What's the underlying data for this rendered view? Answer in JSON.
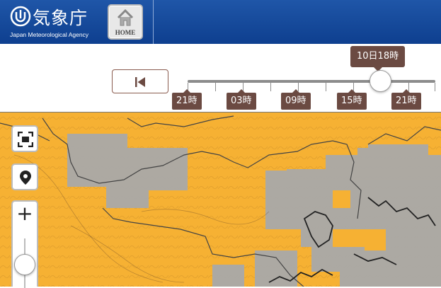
{
  "header": {
    "agency_name_ja": "気象庁",
    "agency_name_en": "Japan Meteorological Agency",
    "home_label": "HOME"
  },
  "timebar": {
    "current_time": "10日18時",
    "ticks": [
      "21時",
      "03時",
      "09時",
      "15時",
      "21時"
    ],
    "slider_position_percent": 78
  },
  "colors": {
    "header_blue": "#1f56a8",
    "label_brown": "#6b4a42",
    "warning_orange": "#f6b133",
    "no_data_gray": "#a9a9a9"
  },
  "map_controls": {
    "fullscreen_icon": "fullscreen-icon",
    "location_icon": "location-pin-icon",
    "zoom_in_icon": "zoom-in-icon"
  }
}
